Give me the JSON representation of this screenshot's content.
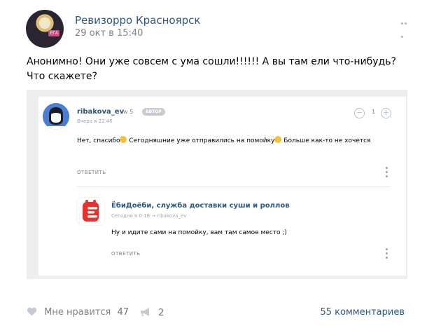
{
  "post": {
    "author": "Ревизорро Красноярск",
    "date": "29 окт в 15:40",
    "avatar_badge": "ЕГА",
    "text": "Анонимно! Они уже совсем с ума сошли!!!!!! А вы там ели что-нибудь? Что скажете?"
  },
  "comment": {
    "author": "ribakova_ev",
    "level": "w 5",
    "tag": "АВТОР",
    "date": "Вчера в 22:46",
    "text_1": "Нет, спасибо",
    "text_2": " Сегодняшние уже отправились на помойку",
    "text_3": " Больше как-то не хочется",
    "likes": "1",
    "minus": "−",
    "plus": "+",
    "reply": "ОТВЕТИТЬ"
  },
  "sub_comment": {
    "author": "ЁбиДоёби, служба доставки суши и роллов",
    "date": "Сегодня в 0:18",
    "reply_to": "ribakova_ev",
    "arrow": "→",
    "text": "Ну и идите сами на помойку, вам там самое место ;)",
    "reply": "ОТВЕТИТЬ"
  },
  "footer": {
    "like_label": "Мне нравится",
    "like_count": "47",
    "share_count": "2",
    "comments_label": "55 комментариев"
  },
  "colors": {
    "link": "#2a5885",
    "muted": "#828282",
    "card_bg": "#edeef0",
    "logo_red": "#e6312e"
  }
}
